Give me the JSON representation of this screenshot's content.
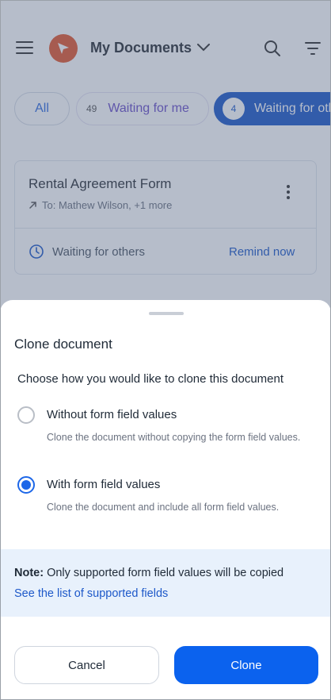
{
  "header": {
    "title": "My Documents"
  },
  "filters": [
    {
      "label": "All",
      "count": ""
    },
    {
      "label": "Waiting for me",
      "count": "49"
    },
    {
      "label": "Waiting for others",
      "count": "4"
    }
  ],
  "document": {
    "title": "Rental Agreement Form",
    "recipients": "To: Mathew Wilson, +1 more",
    "status": "Waiting for others",
    "action": "Remind now"
  },
  "sheet": {
    "title": "Clone document",
    "prompt": "Choose how you would like to clone this document",
    "options": [
      {
        "label": "Without form field values",
        "description": "Clone the document without copying the form field values.",
        "selected": false
      },
      {
        "label": "With form field values",
        "description": "Clone the document and include all form field values.",
        "selected": true
      }
    ],
    "note_prefix": "Note:",
    "note_text": "Only supported form field values will be copied",
    "note_link": "See the list of supported fields",
    "cancel_label": "Cancel",
    "clone_label": "Clone"
  },
  "colors": {
    "accent": "#0b62ee",
    "brand_logo": "#e4572e",
    "note_background": "#e8f1fc",
    "overlay": "#526280"
  },
  "icons": [
    "menu-icon",
    "app-logo-icon",
    "chevron-down-icon",
    "search-icon",
    "filter-icon",
    "arrow-up-right-icon",
    "more-vertical-icon",
    "clock-icon"
  ]
}
